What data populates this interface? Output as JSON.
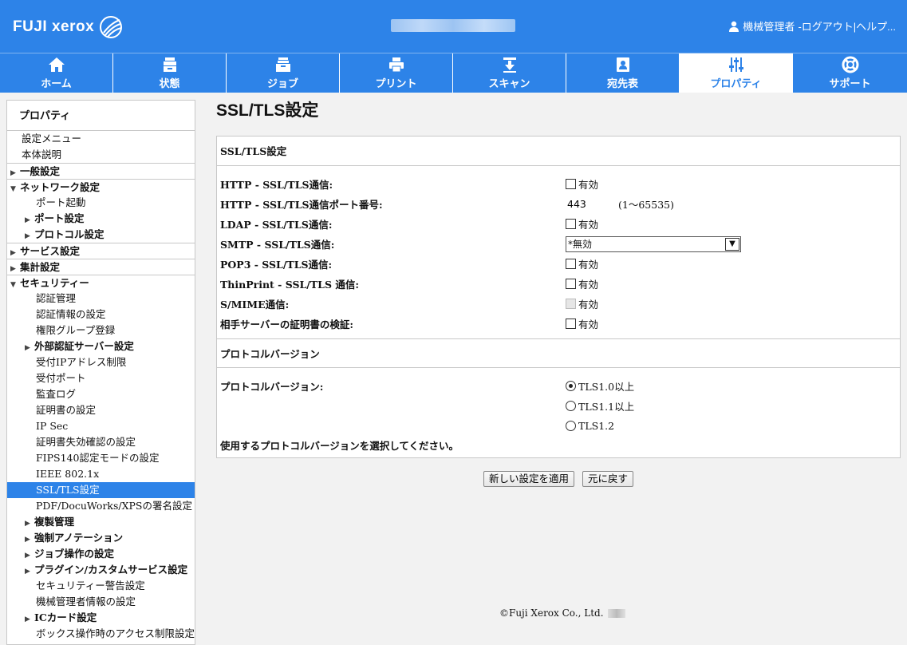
{
  "header": {
    "brand": "FUJI xerox",
    "user_name": "機械管理者",
    "logout": "-ログアウト|",
    "help": "ヘルプ..."
  },
  "nav": {
    "tabs": [
      {
        "label": "ホーム",
        "icon": "home-icon"
      },
      {
        "label": "状態",
        "icon": "printer-status-icon"
      },
      {
        "label": "ジョブ",
        "icon": "job-tray-icon"
      },
      {
        "label": "プリント",
        "icon": "print-icon"
      },
      {
        "label": "スキャン",
        "icon": "scan-icon"
      },
      {
        "label": "宛先表",
        "icon": "address-book-icon"
      },
      {
        "label": "プロパティ",
        "icon": "sliders-icon"
      },
      {
        "label": "サポート",
        "icon": "lifebuoy-icon"
      }
    ],
    "active_index": 6
  },
  "sidebar": {
    "title": "プロパティ",
    "items": [
      {
        "label": "設定メニュー"
      },
      {
        "label": "本体説明"
      },
      {
        "label": "一般設定"
      },
      {
        "label": "ネットワーク設定"
      },
      {
        "label": "ポート起動"
      },
      {
        "label": "ポート設定"
      },
      {
        "label": "プロトコル設定"
      },
      {
        "label": "サービス設定"
      },
      {
        "label": "集計設定"
      },
      {
        "label": "セキュリティー"
      },
      {
        "label": "認証管理"
      },
      {
        "label": "認証情報の設定"
      },
      {
        "label": "権限グループ登録"
      },
      {
        "label": "外部認証サーバー設定"
      },
      {
        "label": "受付IPアドレス制限"
      },
      {
        "label": "受付ポート"
      },
      {
        "label": "監査ログ"
      },
      {
        "label": "証明書の設定"
      },
      {
        "label": "IP Sec"
      },
      {
        "label": "証明書失効確認の設定"
      },
      {
        "label": "FIPS140認定モードの設定"
      },
      {
        "label": "IEEE 802.1x"
      },
      {
        "label": "SSL/TLS設定"
      },
      {
        "label": "PDF/DocuWorks/XPSの署名設定"
      },
      {
        "label": "複製管理"
      },
      {
        "label": "強制アノテーション"
      },
      {
        "label": "ジョブ操作の設定"
      },
      {
        "label": "プラグイン/カスタムサービス設定"
      },
      {
        "label": "セキュリティー警告設定"
      },
      {
        "label": "機械管理者情報の設定"
      },
      {
        "label": "ICカード設定"
      },
      {
        "label": "ボックス操作時のアクセス制限設定"
      }
    ]
  },
  "main": {
    "title": "SSL/TLS設定",
    "ssl_section": {
      "heading": "SSL/TLS設定",
      "rows": [
        {
          "label": "HTTP - SSL/TLS通信:",
          "control": "有効"
        },
        {
          "label": "HTTP - SSL/TLS通信ポート番号:",
          "value": "443",
          "range": "(1〜65535)"
        },
        {
          "label": "LDAP - SSL/TLS通信:",
          "control": "有効"
        },
        {
          "label": "SMTP - SSL/TLS通信:",
          "selected": "*無効"
        },
        {
          "label": "POP3 - SSL/TLS通信:",
          "control": "有効"
        },
        {
          "label": "ThinPrint - SSL/TLS 通信:",
          "control": "有効"
        },
        {
          "label": "S/MIME通信:",
          "control": "有効"
        },
        {
          "label": "相手サーバーの証明書の検証:",
          "control": "有効"
        }
      ]
    },
    "protocol_section": {
      "heading": "プロトコルバージョン",
      "label": "プロトコルバージョン:",
      "options": [
        "TLS1.0以上",
        "TLS1.1以上",
        "TLS1.2"
      ],
      "selected_index": 0,
      "note": "使用するプロトコルバージョンを選択してください。"
    },
    "buttons": {
      "apply": "新しい設定を適用",
      "back": "元に戻す"
    }
  },
  "footer": {
    "copyright": "©Fuji Xerox Co., Ltd."
  }
}
